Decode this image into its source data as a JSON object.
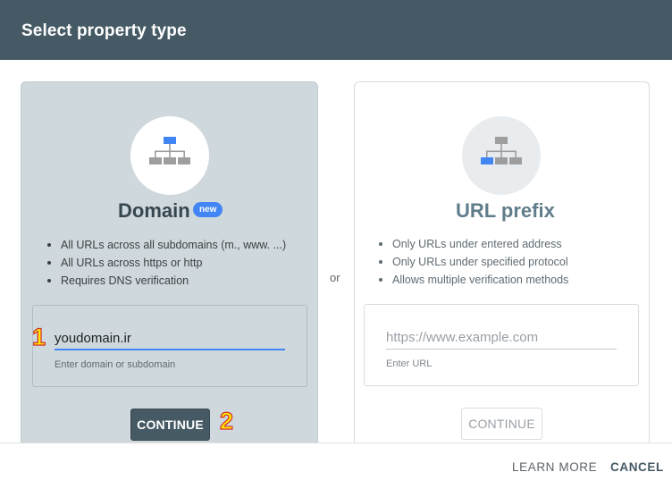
{
  "dialog": {
    "title": "Select property type"
  },
  "domain_card": {
    "title": "Domain",
    "badge": "new",
    "bullets": [
      "All URLs across all subdomains (m., www. ...)",
      "All URLs across https or http",
      "Requires DNS verification"
    ],
    "input_value": "youdomain.ir",
    "helper": "Enter domain or subdomain",
    "continue_label": "CONTINUE",
    "icon": "sitemap-icon"
  },
  "separator": "or",
  "url_card": {
    "title": "URL prefix",
    "bullets": [
      "Only URLs under entered address",
      "Only URLs under specified protocol",
      "Allows multiple verification methods"
    ],
    "input_placeholder": "https://www.example.com",
    "input_value": "",
    "helper": "Enter URL",
    "continue_label": "CONTINUE",
    "icon": "sitemap-icon"
  },
  "annotations": {
    "step1": "1",
    "step2": "2"
  },
  "footer": {
    "learn_more": "LEARN MORE",
    "cancel": "CANCEL"
  },
  "colors": {
    "header_bg": "#455a64",
    "selected_card_bg": "#cfd8dc",
    "accent_blue": "#4285f4",
    "annotation_fill": "#ffeb00",
    "annotation_stroke": "#d32f2f"
  }
}
